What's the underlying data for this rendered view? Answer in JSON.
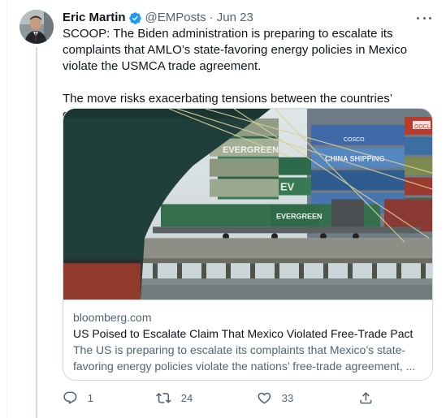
{
  "author": {
    "name": "Eric Martin",
    "handle": "@EMPosts",
    "separator": "·",
    "date": "Jun 23"
  },
  "tweet": {
    "paragraph_1": "SCOOP: The Biden administration is preparing to escalate its complaints that AMLO’s state-favoring energy policies in Mexico violate the USMCA trade agreement.",
    "paragraph_2": "The move risks exacerbating tensions between the countries’ governments."
  },
  "card": {
    "image_text": [
      "EVERGREEN",
      "CHINA SHIPPING",
      "COSCO",
      "OOCL",
      "EV"
    ],
    "domain": "bloomberg.com",
    "title": "US Poised to Escalate Claim That Mexico Violated Free-Trade Pact",
    "description": "The US is preparing to escalate its complaints that Mexico’s state-favoring energy policies violate the nations’ free-trade agreement, ..."
  },
  "actions": {
    "reply_count": "1",
    "retweet_count": "24",
    "like_count": "33"
  },
  "icons": {
    "verified": "verified-badge-icon",
    "more": "more-icon",
    "reply": "reply-icon",
    "retweet": "retweet-icon",
    "like": "heart-icon",
    "share": "share-icon"
  },
  "colors": {
    "verified": "#1d9bf0",
    "secondary_text": "#536471",
    "border": "#cfd9de"
  }
}
